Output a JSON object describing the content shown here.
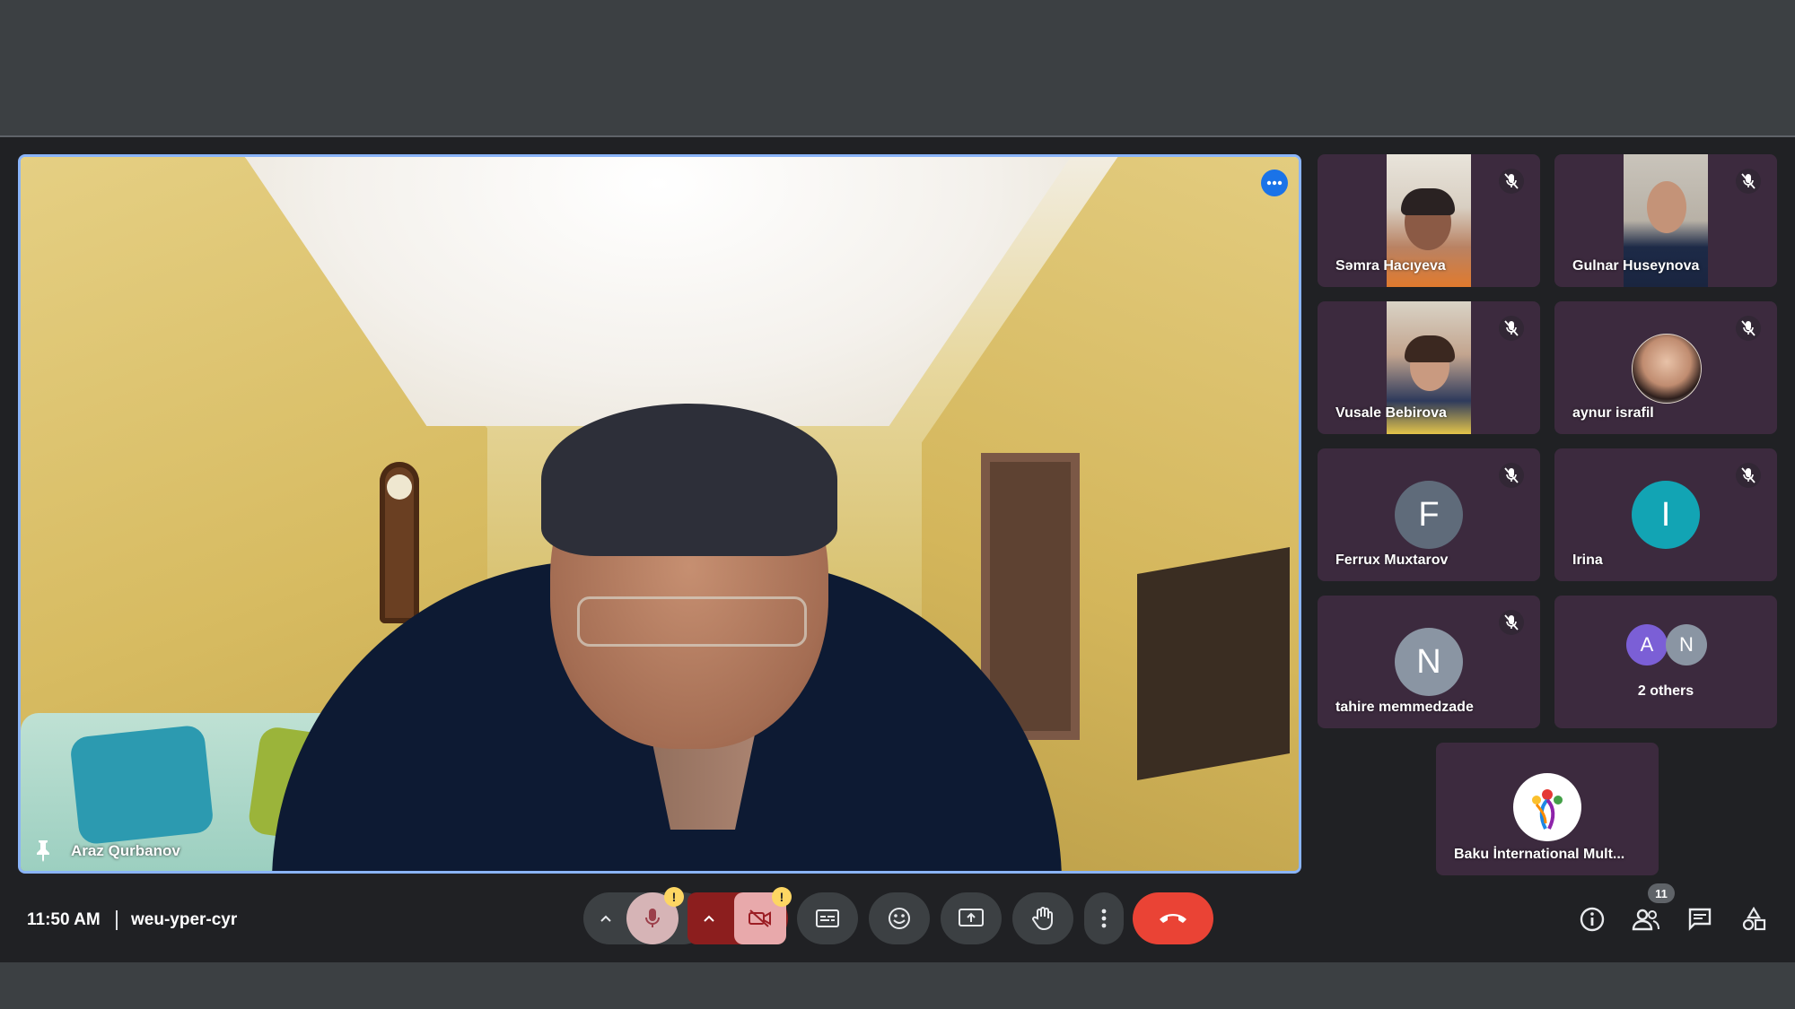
{
  "main_speaker": {
    "name": "Araz Qurbanov"
  },
  "participants": [
    {
      "name": "Səmra Hacıyeva",
      "type": "video",
      "muted": true
    },
    {
      "name": "Gulnar Huseynova",
      "type": "video",
      "muted": true
    },
    {
      "name": "Vusale Bebirova",
      "type": "video",
      "muted": true
    },
    {
      "name": "aynur israfil",
      "type": "photo",
      "muted": true
    },
    {
      "name": "Ferrux Muxtarov",
      "type": "initial",
      "initial": "F",
      "color": "#5f6b7a",
      "muted": true
    },
    {
      "name": "Irina",
      "type": "initial",
      "initial": "I",
      "color": "#12a4b4",
      "muted": true
    },
    {
      "name": "tahire memmedzade",
      "type": "initial",
      "initial": "N",
      "color": "#8a95a3",
      "muted": true
    }
  ],
  "others": {
    "label": "2 others",
    "initials": [
      "A",
      "N"
    ],
    "colors": [
      "#7b5fd6",
      "#8a95a3"
    ]
  },
  "presenter_tile": {
    "name": "Baku İnternational Mult..."
  },
  "bottom_bar": {
    "time": "11:50 AM",
    "separator": "|",
    "meeting_code": "weu-yper-cyr",
    "mic_alert": "!",
    "camera_alert": "!",
    "people_count": "11"
  },
  "colors": {
    "end_call": "#ea4335",
    "camera_off_bg": "#8c1e1e",
    "active_border": "#8ab4f8"
  }
}
